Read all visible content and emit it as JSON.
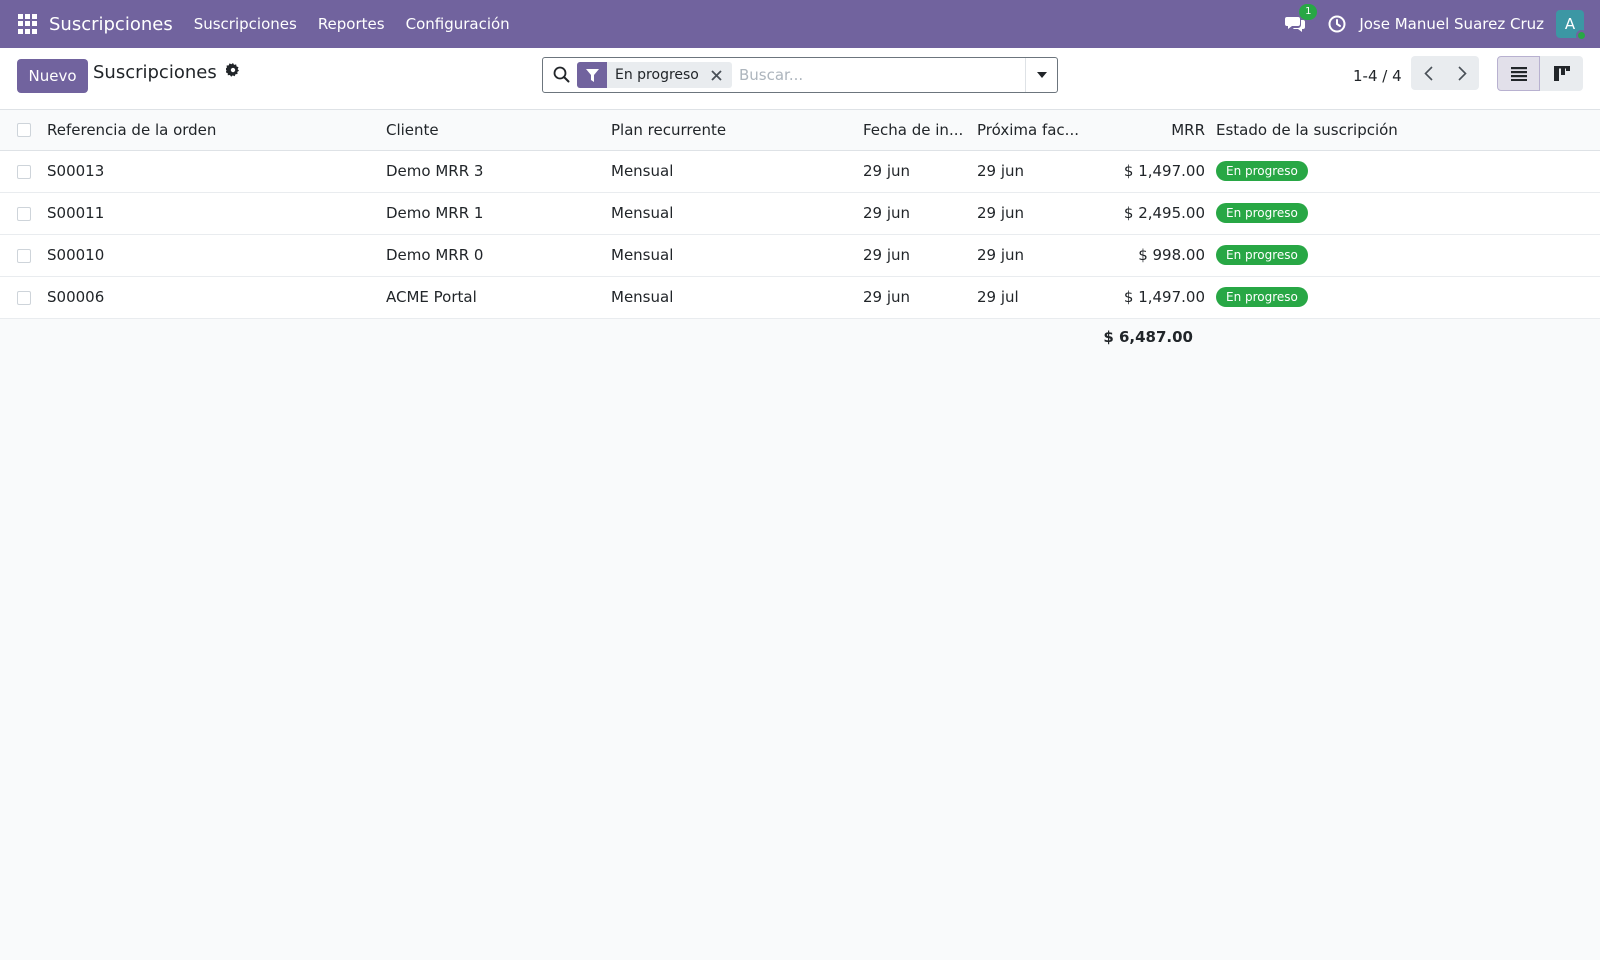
{
  "navbar": {
    "brand": "Suscripciones",
    "menu": [
      "Suscripciones",
      "Reportes",
      "Configuración"
    ],
    "chat_count": "1",
    "user_name": "Jose Manuel Suarez Cruz",
    "avatar_letter": "A"
  },
  "control_panel": {
    "new_button": "Nuevo",
    "title": "Suscripciones",
    "facet_label": "En progreso",
    "search_placeholder": "Buscar...",
    "pager": "1-4 / 4"
  },
  "table": {
    "columns": [
      "Referencia de la orden",
      "Cliente",
      "Plan recurrente",
      "Fecha de in...",
      "Próxima fac...",
      "MRR",
      "Estado de la suscripción"
    ],
    "rows": [
      {
        "ref": "S00013",
        "client": "Demo MRR 3",
        "plan": "Mensual",
        "start": "29 jun",
        "next": "29 jun",
        "mrr": "$ 1,497.00",
        "state": "En progreso"
      },
      {
        "ref": "S00011",
        "client": "Demo MRR 1",
        "plan": "Mensual",
        "start": "29 jun",
        "next": "29 jun",
        "mrr": "$ 2,495.00",
        "state": "En progreso"
      },
      {
        "ref": "S00010",
        "client": "Demo MRR 0",
        "plan": "Mensual",
        "start": "29 jun",
        "next": "29 jun",
        "mrr": "$ 998.00",
        "state": "En progreso"
      },
      {
        "ref": "S00006",
        "client": "ACME Portal",
        "plan": "Mensual",
        "start": "29 jun",
        "next": "29 jul",
        "mrr": "$ 1,497.00",
        "state": "En progreso"
      }
    ],
    "total_mrr": "$ 6,487.00"
  },
  "colors": {
    "primary": "#71639e",
    "success": "#28a745"
  }
}
